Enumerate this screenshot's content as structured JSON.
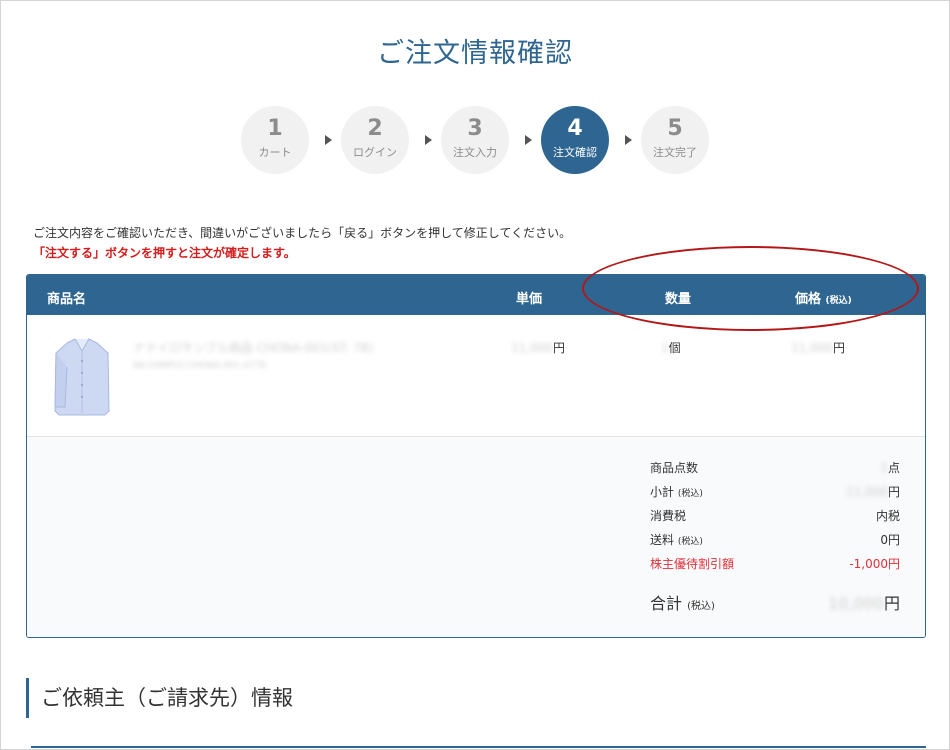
{
  "page_title": "ご注文情報確認",
  "steps": [
    {
      "num": "1",
      "label": "カート"
    },
    {
      "num": "2",
      "label": "ログイン"
    },
    {
      "num": "3",
      "label": "注文入力"
    },
    {
      "num": "4",
      "label": "注文確認"
    },
    {
      "num": "5",
      "label": "注文完了"
    }
  ],
  "notes": {
    "line1": "ご注文内容をご確認いただき、間違いがございましたら「戻る」ボタンを押して修正してください。",
    "line2": "「注文する」ボタンを押すと注文が確定します。"
  },
  "table": {
    "headers": {
      "name": "商品名",
      "unit_price": "単価",
      "quantity": "数量",
      "price": "価格",
      "price_note": "(税込)"
    },
    "item": {
      "name": "ナナイロサンプル商品 CHONA-001(ST. 78)",
      "code": "NK-SAMPLE-CHONA-001-ST78",
      "unit_price_value": "11,000",
      "unit_price_suffix": "円",
      "quantity_value": "1",
      "quantity_suffix": "個",
      "price_value": "11,000",
      "price_suffix": "円"
    }
  },
  "summary": {
    "count_label": "商品点数",
    "count_value": "1",
    "count_suffix": "点",
    "subtotal_label": "小計",
    "subtotal_note": "(税込)",
    "subtotal_value": "11,000",
    "subtotal_suffix": "円",
    "tax_label": "消費税",
    "tax_value": "内税",
    "shipping_label": "送料",
    "shipping_note": "(税込)",
    "shipping_value": "0円",
    "discount_label": "株主優待割引額",
    "discount_value": "-1,000円",
    "total_label": "合計",
    "total_note": "(税込)",
    "total_value": "10,000",
    "total_suffix": "円"
  },
  "section_heading": "ご依頼主（ご請求先）情報",
  "colors": {
    "primary": "#2e6591",
    "alert": "#d61c1c",
    "discount": "#e0303a"
  }
}
